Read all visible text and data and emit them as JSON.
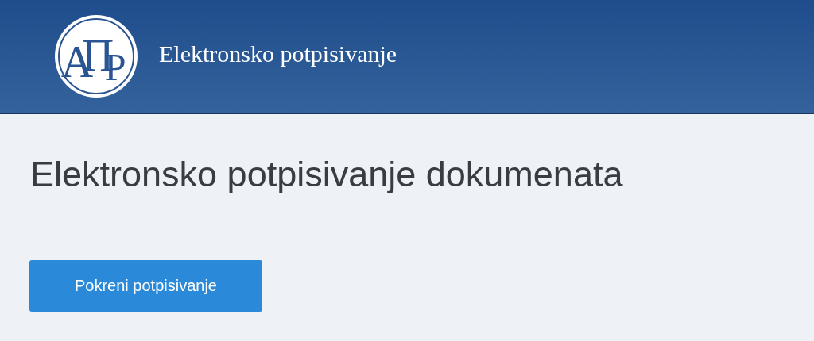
{
  "header": {
    "logo_letters": [
      "А",
      "П",
      "Р"
    ],
    "title": "Elektronsko potpisivanje"
  },
  "heading": "Elektronsko potpisivanje dokumenata",
  "button": {
    "label": "Pokreni potpisivanje"
  }
}
